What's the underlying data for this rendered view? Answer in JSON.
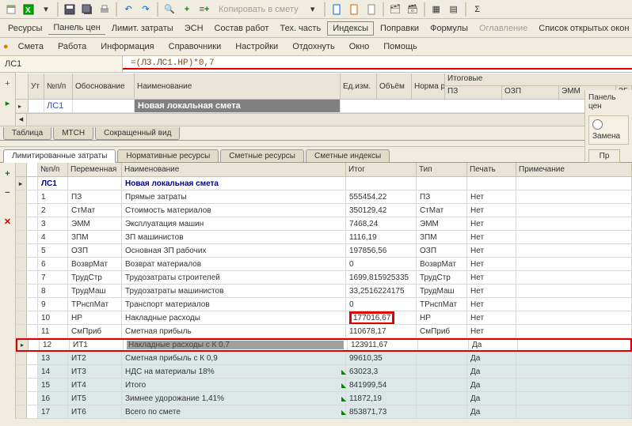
{
  "toolbar1": {
    "copy_label": "Копировать в смету"
  },
  "toolbar2": {
    "items": [
      "Ресурсы",
      "Панель цен",
      "Лимит. затраты",
      "ЭСН",
      "Состав работ",
      "Тех. часть",
      "Индексы",
      "Поправки",
      "Формулы",
      "Оглавление",
      "Список открытых окон"
    ]
  },
  "menu": {
    "items": [
      "Смета",
      "Работа",
      "Информация",
      "Справочники",
      "Настройки",
      "Отдохнуть",
      "Окно",
      "Помощь"
    ]
  },
  "formula": {
    "cell": "ЛС1",
    "expr": "=(ЛЗ.ЛС1.НР)*0,7"
  },
  "upper_grid": {
    "headers": {
      "ut": "Ут",
      "num": "№п/п",
      "obosn": "Обоснование",
      "name": "Наименование",
      "ed": "Ед.изм.",
      "obem": "Объём",
      "norma": "Норма расход",
      "itog": "Итоговые",
      "pz": "ПЗ",
      "ozp": "ОЗП",
      "emm": "ЭММ",
      "zp": "ЗГ"
    },
    "row": {
      "num": "ЛС1",
      "name": "Новая локальная смета"
    }
  },
  "upper_tabs": [
    "Таблица",
    "МТСН",
    "Сокращенный вид"
  ],
  "lower_tabs": [
    "Лимитированные затраты",
    "Нормативные ресурсы",
    "Сметные ресурсы",
    "Сметные индексы"
  ],
  "lower_headers": {
    "num": "№п/п",
    "var": "Переменная",
    "name": "Наименование",
    "itog": "Итог",
    "tip": "Тип",
    "print": "Печать",
    "note": "Примечание"
  },
  "lower_title_row": {
    "num": "ЛС1",
    "name": "Новая локальная смета"
  },
  "lower_rows": [
    {
      "n": "1",
      "var": "ПЗ",
      "name": "Прямые затраты",
      "itog": "555454,22",
      "tip": "ПЗ",
      "print": "Нет"
    },
    {
      "n": "2",
      "var": "СтМат",
      "name": "Стоимость материалов",
      "itog": "350129,42",
      "tip": "СтМат",
      "print": "Нет"
    },
    {
      "n": "3",
      "var": "ЭММ",
      "name": "Эксплуатация машин",
      "itog": "7468,24",
      "tip": "ЭММ",
      "print": "Нет"
    },
    {
      "n": "4",
      "var": "ЗПМ",
      "name": "ЗП машинистов",
      "itog": "1116,19",
      "tip": "ЗПМ",
      "print": "Нет"
    },
    {
      "n": "5",
      "var": "ОЗП",
      "name": "Основная ЗП рабочих",
      "itog": "197856,56",
      "tip": "ОЗП",
      "print": "Нет"
    },
    {
      "n": "6",
      "var": "ВозврМат",
      "name": "Возврат материалов",
      "itog": "0",
      "tip": "ВозврМат",
      "print": "Нет"
    },
    {
      "n": "7",
      "var": "ТрудСтр",
      "name": "Трудозатраты строителей",
      "itog": "1699,815925335",
      "tip": "ТрудСтр",
      "print": "Нет"
    },
    {
      "n": "8",
      "var": "ТрудМаш",
      "name": "Трудозатраты машинистов",
      "itog": "33,2516224175",
      "tip": "ТрудМаш",
      "print": "Нет"
    },
    {
      "n": "9",
      "var": "ТРнспМат",
      "name": "Транспорт материалов",
      "itog": "0",
      "tip": "ТРнспМат",
      "print": "Нет"
    },
    {
      "n": "10",
      "var": "НР",
      "name": "Накладные расходы",
      "itog": "177016,67",
      "tip": "НР",
      "print": "Нет",
      "itog_red": true
    },
    {
      "n": "11",
      "var": "СмПриб",
      "name": "Сметная прибыль",
      "itog": "110678,17",
      "tip": "СмПриб",
      "print": "Нет"
    },
    {
      "n": "12",
      "var": "ИТ1",
      "name": "Накладные расходы с К 0,7",
      "itog": "123911,67",
      "tip": "",
      "print": "Да",
      "row_red": true,
      "gray_name": true
    },
    {
      "n": "13",
      "var": "ИТ2",
      "name": "Сметная прибыль с К 0,9",
      "itog": "99610,35",
      "tip": "",
      "print": "Да",
      "alt": true
    },
    {
      "n": "14",
      "var": "ИТ3",
      "name": "НДС на материалы  18%",
      "itog": "63023,3",
      "tip": "",
      "print": "Да",
      "alt": true,
      "tri": true
    },
    {
      "n": "15",
      "var": "ИТ4",
      "name": "Итого",
      "itog": "841999,54",
      "tip": "",
      "print": "Да",
      "alt": true,
      "tri": true
    },
    {
      "n": "16",
      "var": "ИТ5",
      "name": "Зимнее удорожание 1,41%",
      "itog": "11872,19",
      "tip": "",
      "print": "Да",
      "alt": true,
      "tri": true
    },
    {
      "n": "17",
      "var": "ИТ6",
      "name": "Всего по смете",
      "itog": "853871,73",
      "tip": "",
      "print": "Да",
      "alt": true,
      "tri": true
    }
  ],
  "right_panel": {
    "title": "Панель цен",
    "replace": "Замена",
    "btn": "Пр"
  }
}
